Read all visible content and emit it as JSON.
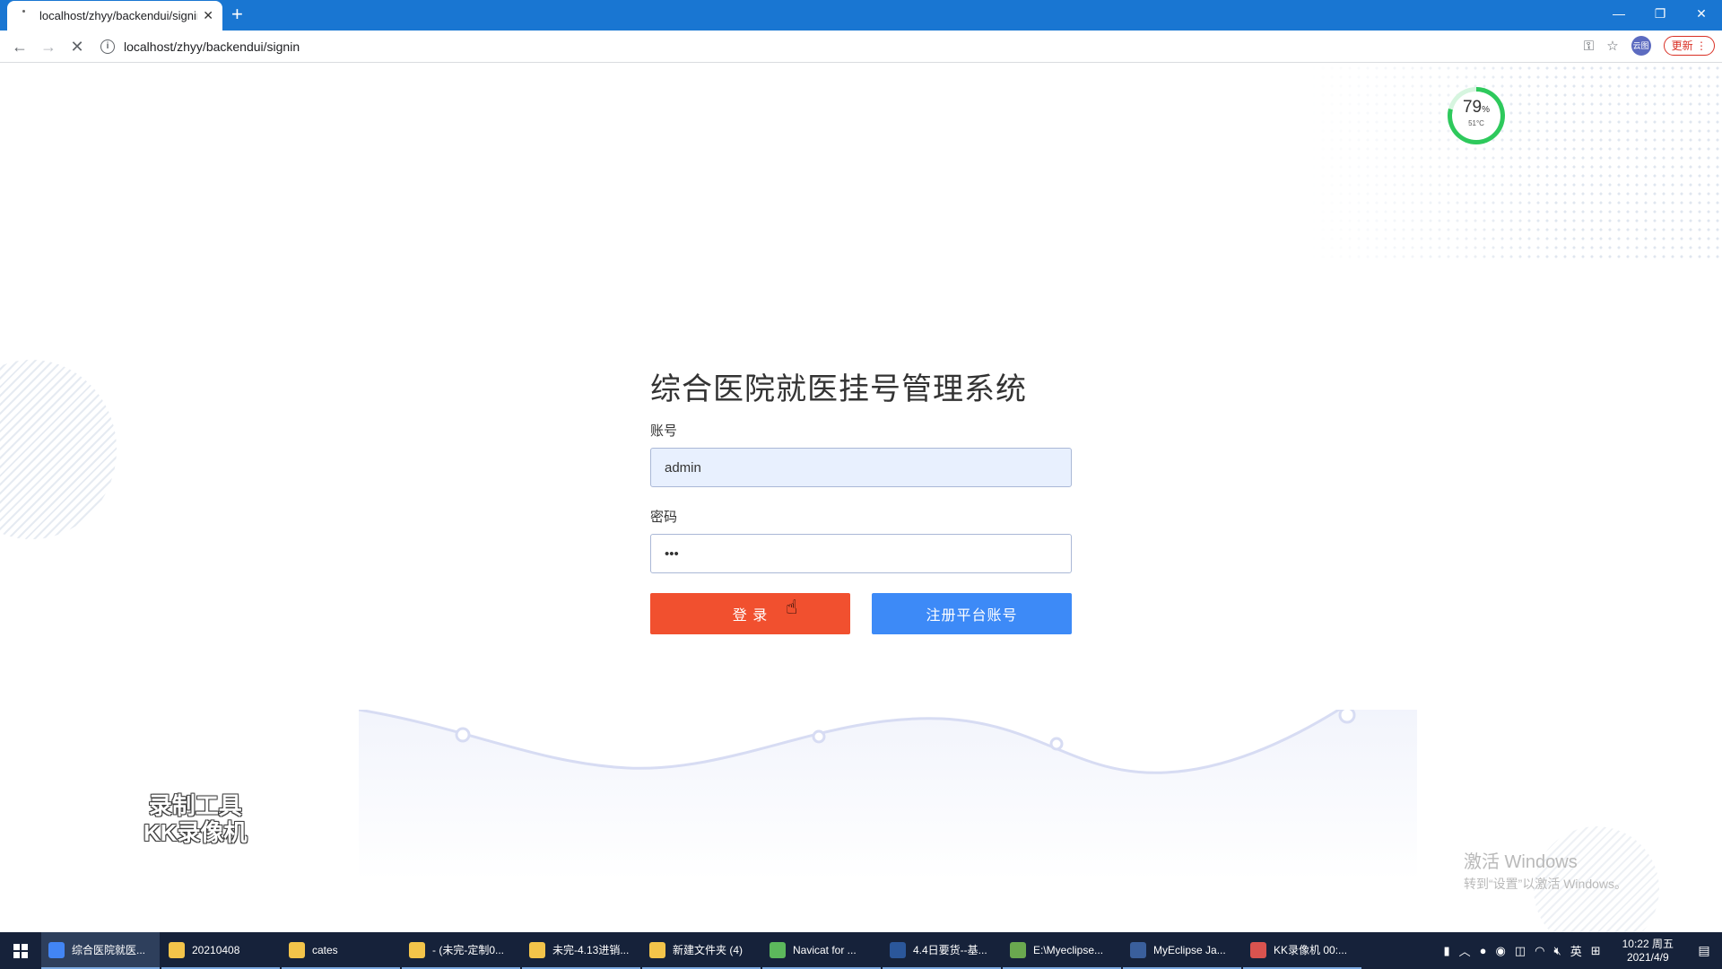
{
  "browser": {
    "tab_title": "localhost/zhyy/backendui/signin",
    "tab_close": "✕",
    "new_tab": "+",
    "url": "localhost/zhyy/backendui/signin",
    "profile_label": "云图",
    "update_label": "更新"
  },
  "gauge": {
    "percent": "79",
    "percent_unit": "%",
    "temperature": "51°C"
  },
  "login": {
    "title": "综合医院就医挂号管理系统",
    "account_label": "账号",
    "account_value": "admin",
    "password_label": "密码",
    "password_value": "•••",
    "login_button": "登 录",
    "register_button": "注册平台账号"
  },
  "watermark": {
    "line1": "录制工具",
    "line2": "KK录像机"
  },
  "activate": {
    "line1": "激活 Windows",
    "line2": "转到“设置”以激活 Windows。"
  },
  "taskbar": {
    "items": [
      {
        "label": "综合医院就医...",
        "icon": "chrome-icon",
        "color": "#4285f4"
      },
      {
        "label": "20210408",
        "icon": "folder-icon",
        "color": "#f3c44a"
      },
      {
        "label": "cates",
        "icon": "folder-icon",
        "color": "#f3c44a"
      },
      {
        "label": "- (未完-定制0...",
        "icon": "folder-icon",
        "color": "#f3c44a"
      },
      {
        "label": "未完-4.13进销...",
        "icon": "folder-icon",
        "color": "#f3c44a"
      },
      {
        "label": "新建文件夹 (4)",
        "icon": "folder-icon",
        "color": "#f3c44a"
      },
      {
        "label": "Navicat for ...",
        "icon": "navicat-icon",
        "color": "#5cb85c"
      },
      {
        "label": "4.4日要货--基...",
        "icon": "word-icon",
        "color": "#2b579a"
      },
      {
        "label": "E:\\Myeclipse...",
        "icon": "notepad-icon",
        "color": "#6aa84f"
      },
      {
        "label": "MyEclipse Ja...",
        "icon": "myeclipse-icon",
        "color": "#3a5f9c"
      },
      {
        "label": "KK录像机 00:...",
        "icon": "kk-recorder-icon",
        "color": "#d9534f"
      }
    ],
    "ime": "英",
    "time": "10:22 周五",
    "date": "2021/4/9"
  }
}
